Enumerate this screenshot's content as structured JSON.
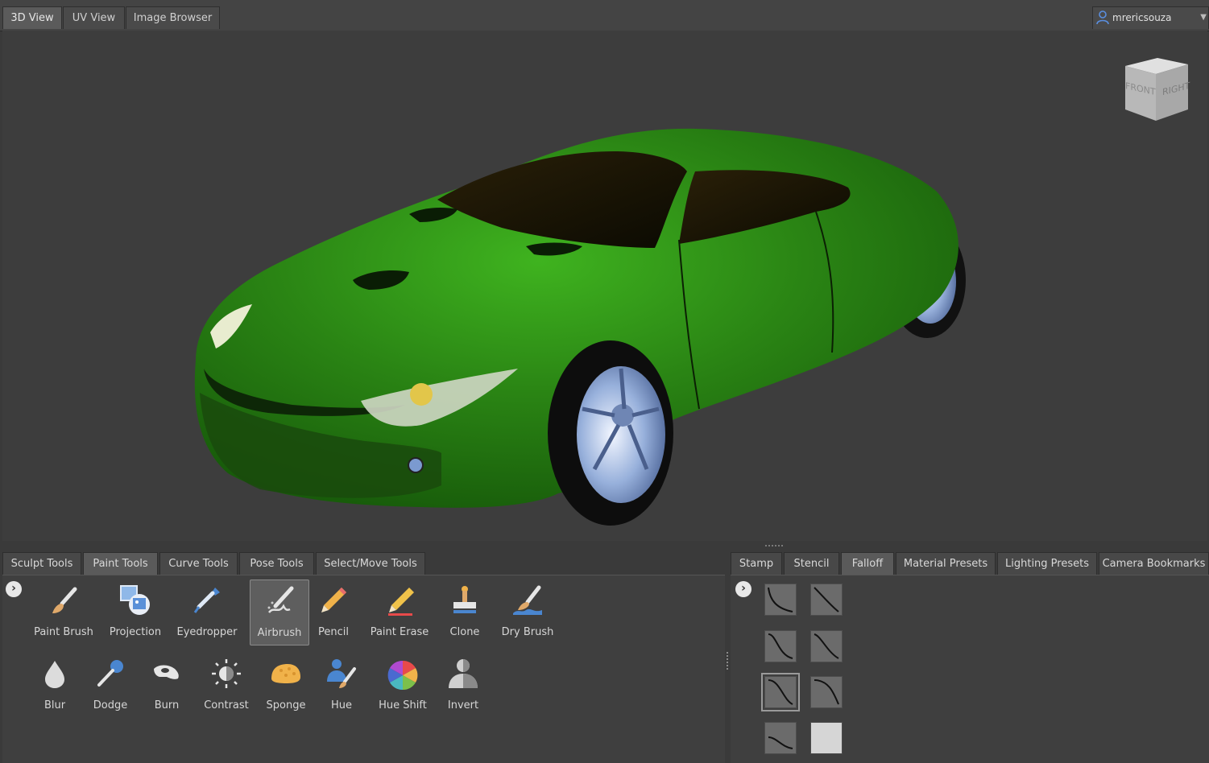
{
  "view_tabs": [
    {
      "label": "3D View",
      "active": true
    },
    {
      "label": "UV View",
      "active": false
    },
    {
      "label": "Image Browser",
      "active": false
    }
  ],
  "user": {
    "name": "mrericsouza",
    "icon": "user-icon"
  },
  "viewcube": {
    "front": "FRONT",
    "right": "RIGHT"
  },
  "tool_tabs": [
    {
      "label": "Sculpt Tools",
      "active": false
    },
    {
      "label": "Paint Tools",
      "active": true
    },
    {
      "label": "Curve Tools",
      "active": false
    },
    {
      "label": "Pose Tools",
      "active": false
    },
    {
      "label": "Select/Move Tools",
      "active": false
    }
  ],
  "tray_tabs": [
    {
      "label": "Stamp",
      "active": false
    },
    {
      "label": "Stencil",
      "active": false
    },
    {
      "label": "Falloff",
      "active": true
    },
    {
      "label": "Material Presets",
      "active": false
    },
    {
      "label": "Lighting Presets",
      "active": false
    },
    {
      "label": "Camera Bookmarks",
      "active": false
    }
  ],
  "paint_tools_row1": [
    {
      "label": "Paint Brush",
      "icon": "paint-brush-icon"
    },
    {
      "label": "Projection",
      "icon": "projection-icon"
    },
    {
      "label": "Eyedropper",
      "icon": "eyedropper-icon"
    },
    {
      "label": "Airbrush",
      "icon": "airbrush-icon",
      "selected": true
    },
    {
      "label": "Pencil",
      "icon": "pencil-icon"
    },
    {
      "label": "Paint Erase",
      "icon": "paint-erase-icon"
    },
    {
      "label": "Clone",
      "icon": "clone-stamp-icon"
    },
    {
      "label": "Dry Brush",
      "icon": "dry-brush-icon"
    }
  ],
  "paint_tools_row2": [
    {
      "label": "Blur",
      "icon": "blur-drop-icon"
    },
    {
      "label": "Dodge",
      "icon": "dodge-icon"
    },
    {
      "label": "Burn",
      "icon": "burn-hand-icon"
    },
    {
      "label": "Contrast",
      "icon": "contrast-sun-icon"
    },
    {
      "label": "Sponge",
      "icon": "sponge-icon"
    },
    {
      "label": "Hue",
      "icon": "hue-icon"
    },
    {
      "label": "Hue Shift",
      "icon": "hue-shift-wheel-icon"
    },
    {
      "label": "Invert",
      "icon": "invert-person-icon"
    }
  ],
  "falloff_presets": [
    {
      "icon": "falloff-curve-icon"
    },
    {
      "icon": "falloff-curve-icon"
    },
    {
      "icon": "falloff-curve-icon"
    },
    {
      "icon": "falloff-curve-icon"
    },
    {
      "icon": "falloff-curve-icon",
      "selected": true
    },
    {
      "icon": "falloff-curve-icon"
    },
    {
      "icon": "falloff-curve-icon"
    },
    {
      "icon": "falloff-flat-icon"
    }
  ],
  "colors": {
    "car_body": "#2f8a1a",
    "car_dark": "#0f3a08",
    "wheel_rim": "#8aa6d6",
    "viewport_bg": "#3d3d3d"
  }
}
